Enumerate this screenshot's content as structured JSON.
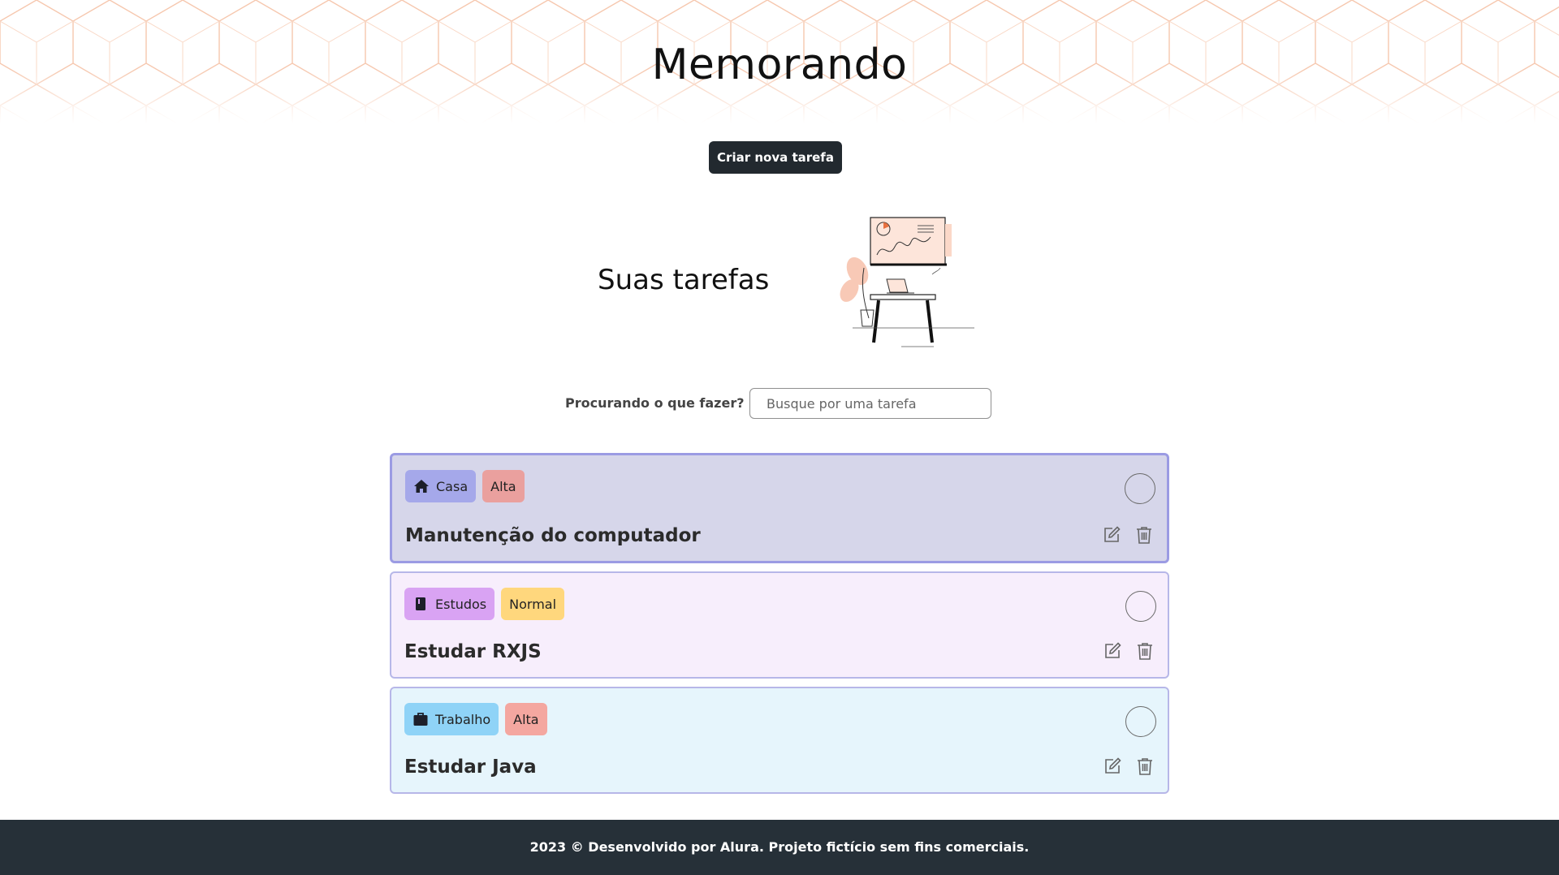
{
  "header": {
    "title": "Memorando"
  },
  "toolbar": {
    "create_label": "Criar nova tarefa"
  },
  "section": {
    "title": "Suas tarefas"
  },
  "search": {
    "label": "Procurando o que fazer?",
    "placeholder": "Busque por uma tarefa",
    "value": ""
  },
  "tasks": [
    {
      "name": "Manutenção do computador",
      "category": "Casa",
      "category_icon": "house-icon",
      "priority": "Alta",
      "selected": true,
      "colors": {
        "card_bg": "#d6d6ea",
        "category_bg": "#a5a8ea",
        "priority_bg": "#eaa09e"
      }
    },
    {
      "name": "Estudar RXJS",
      "category": "Estudos",
      "category_icon": "book-icon",
      "priority": "Normal",
      "selected": false,
      "colors": {
        "card_bg": "#f7eefc",
        "category_bg": "#d9a3f3",
        "priority_bg": "#ffd77d"
      }
    },
    {
      "name": "Estudar Java",
      "category": "Trabalho",
      "category_icon": "briefcase-icon",
      "priority": "Alta",
      "selected": false,
      "colors": {
        "card_bg": "#e6f5fc",
        "category_bg": "#8fd3f7",
        "priority_bg": "#f4a7a0"
      }
    }
  ],
  "footer": {
    "text": "2023 © Desenvolvido por Alura. Projeto fictício sem fins comerciais."
  },
  "colors": {
    "accent_dark": "#22292f",
    "footer_bg": "#263038",
    "pattern": "#f6c7ae"
  }
}
